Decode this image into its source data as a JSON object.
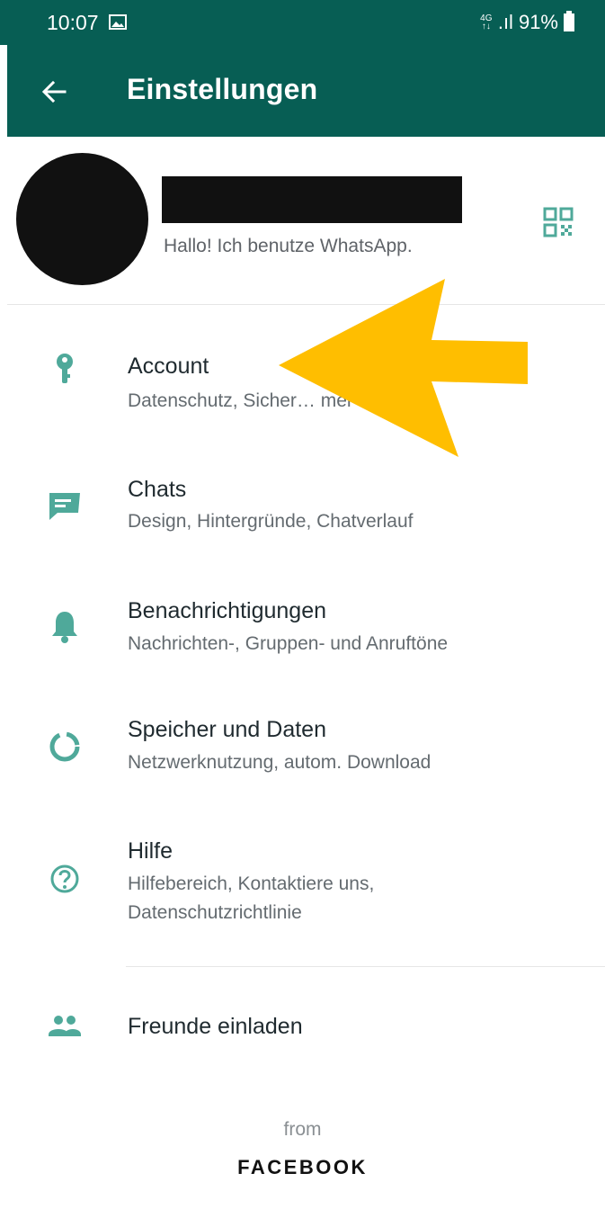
{
  "statusbar": {
    "time": "10:07",
    "network_top": "4G",
    "network_bottom": "↑↓",
    "signal": ".ıl",
    "battery": "91%"
  },
  "appbar": {
    "title": "Einstellungen",
    "back_icon": "arrow-back-icon"
  },
  "profile": {
    "status": "Hallo! Ich benutze WhatsApp.",
    "qr_icon": "qr-code-icon"
  },
  "settings": {
    "items": [
      {
        "title": "Account",
        "subtitle": "Datenschutz, Sicher… mer ändern",
        "icon": "key-icon"
      },
      {
        "title": "Chats",
        "subtitle": "Design, Hintergründe, Chatverlauf",
        "icon": "chat-icon"
      },
      {
        "title": "Benachrichtigungen",
        "subtitle": "Nachrichten-, Gruppen- und Anruftöne",
        "icon": "bell-icon"
      },
      {
        "title": "Speicher und Daten",
        "subtitle": "Netzwerknutzung, autom. Download",
        "icon": "data-usage-icon"
      },
      {
        "title": "Hilfe",
        "subtitle_line1": "Hilfebereich, Kontaktiere uns,",
        "subtitle_line2": "Datenschutzrichtlinie",
        "icon": "help-icon"
      },
      {
        "title": "Freunde einladen",
        "icon": "people-icon"
      }
    ]
  },
  "footer": {
    "from": "from",
    "brand": "FACEBOOK"
  },
  "colors": {
    "header": "#075E54",
    "icon": "#4FA99A",
    "annotation_arrow": "#FFBE00"
  }
}
